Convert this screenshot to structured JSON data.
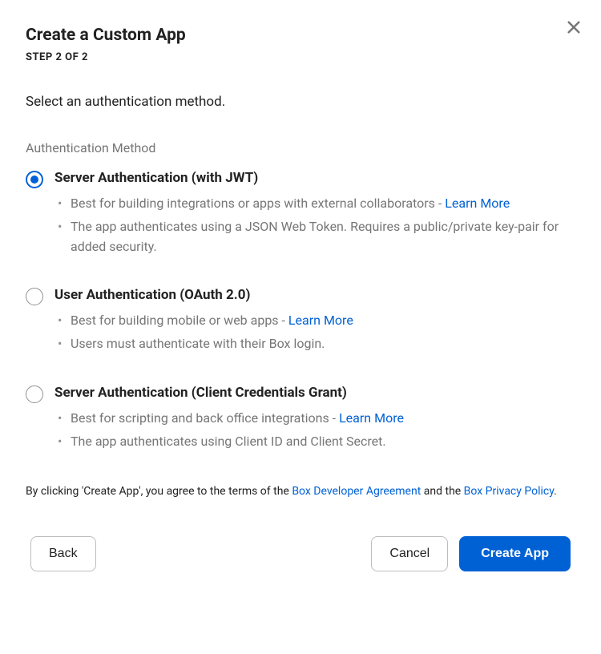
{
  "dialog": {
    "title": "Create a Custom App",
    "step": "STEP 2 OF 2",
    "subtitle": "Select an authentication method.",
    "sectionLabel": "Authentication Method"
  },
  "options": [
    {
      "title": "Server Authentication (with JWT)",
      "selected": true,
      "b1_pre": "Best for building integrations or apps with external collaborators - ",
      "b1_link": "Learn More",
      "b2": "The app authenticates using a JSON Web Token. Requires a public/private key-pair for added security."
    },
    {
      "title": "User Authentication (OAuth 2.0)",
      "selected": false,
      "b1_pre": "Best for building mobile or web apps - ",
      "b1_link": "Learn More",
      "b2": "Users must authenticate with their Box login."
    },
    {
      "title": "Server Authentication (Client Credentials Grant)",
      "selected": false,
      "b1_pre": "Best for scripting and back office integrations - ",
      "b1_link": "Learn More",
      "b2": "The app authenticates using Client ID and Client Secret."
    }
  ],
  "agreement": {
    "pre": "By clicking 'Create App', you agree to the terms of the ",
    "link1": "Box Developer Agreement",
    "mid": " and the ",
    "link2": "Box Privacy Policy",
    "post": "."
  },
  "buttons": {
    "back": "Back",
    "cancel": "Cancel",
    "create": "Create App"
  }
}
